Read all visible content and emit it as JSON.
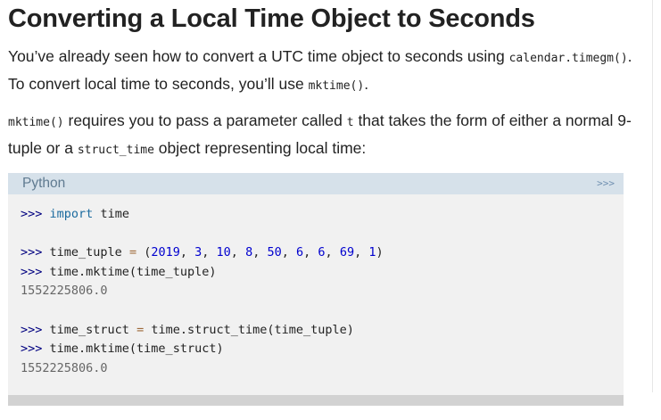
{
  "heading": "Converting a Local Time Object to Seconds",
  "para1": {
    "t1": "You’ve already seen how to convert a UTC time object to seconds using ",
    "c1": "calendar.timegm()",
    "t2": ". To convert local time to seconds, you’ll use ",
    "c2": "mktime()",
    "t3": "."
  },
  "para2": {
    "c1": "mktime()",
    "t1": " requires you to pass a parameter called ",
    "c2": "t",
    "t2": " that takes the form of either a normal 9-tuple or a ",
    "c3": "struct_time",
    "t3": " object representing local time:"
  },
  "code": {
    "language": "Python",
    "prompt_toggle": ">>>",
    "prompt": ">>>",
    "line1": {
      "kw": "import",
      "rest": " time"
    },
    "line2": {
      "name": " time_tuple ",
      "eq": "=",
      "open": " (",
      "nums": [
        "2019",
        "3",
        "10",
        "8",
        "50",
        "6",
        "6",
        "69",
        "1"
      ],
      "close": ")"
    },
    "line3": {
      "rest": " time.mktime(time_tuple)"
    },
    "out1": "1552225806.0",
    "line4": {
      "name": " time_struct ",
      "eq": "=",
      "rest": " time.struct_time(time_tuple)"
    },
    "line5": {
      "rest": " time.mktime(time_struct)"
    },
    "out2": "1552225806.0"
  }
}
